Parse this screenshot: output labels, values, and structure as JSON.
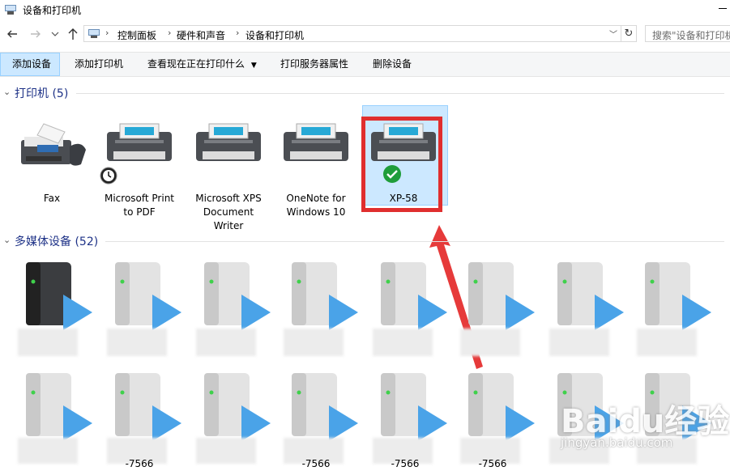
{
  "window": {
    "title": "设备和打印机"
  },
  "nav": {
    "back_icon": "arrow-left-icon",
    "forward_icon": "arrow-right-icon",
    "recent_icon": "chevron-down-icon",
    "up_icon": "arrow-up-icon",
    "breadcrumbs": [
      "控制面板",
      "硬件和声音",
      "设备和打印机"
    ],
    "refresh_icon": "refresh-icon",
    "search_placeholder": "搜索\"设备和打印机\""
  },
  "toolbar": {
    "items": [
      "添加设备",
      "添加打印机",
      "查看现在正在打印什么",
      "打印服务器属性",
      "删除设备"
    ]
  },
  "groups": {
    "printers": {
      "name": "打印机 (5)"
    },
    "media": {
      "name": "多媒体设备 (52)"
    }
  },
  "printers": [
    {
      "label": "Fax",
      "icon": "fax-icon"
    },
    {
      "label": "Microsoft Print to PDF",
      "icon": "printer-icon",
      "badge": "clock-badge"
    },
    {
      "label": "Microsoft XPS Document Writer",
      "icon": "printer-icon"
    },
    {
      "label": "OneNote for Windows 10",
      "icon": "printer-icon"
    },
    {
      "label": "XP-58",
      "icon": "printer-icon",
      "badge": "default-check-badge",
      "selected": true
    }
  ],
  "media_label_fragment": "-7566",
  "watermark": {
    "logo": "Baidu经验",
    "url": "jingyan.baidu.com"
  },
  "colors": {
    "selection": "#cce8ff",
    "annotation_red": "#e02e2e",
    "group_header": "#1e3287",
    "media_play": "#4aa3e8"
  }
}
